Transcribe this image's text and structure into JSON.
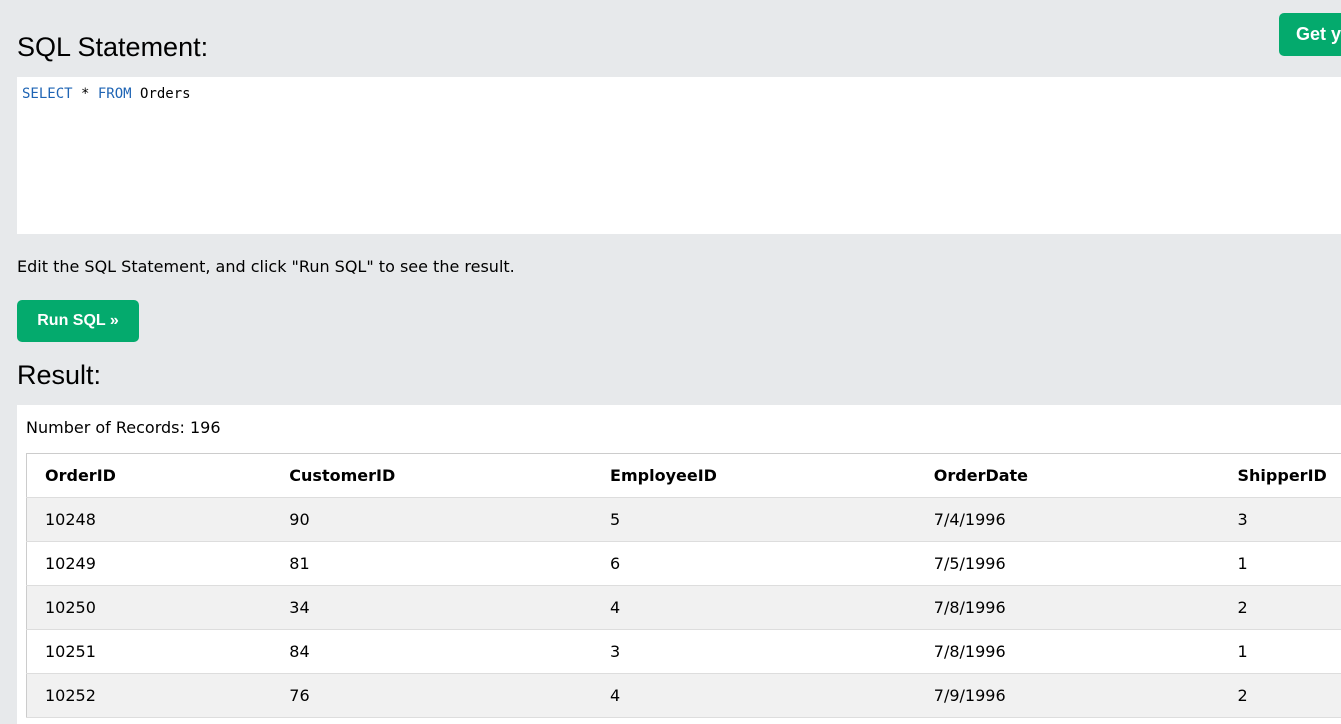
{
  "header": {
    "title": "SQL Statement:",
    "get_button_label": "Get y"
  },
  "editor": {
    "tokens": [
      {
        "text": "SELECT",
        "type": "keyword"
      },
      {
        "text": " * ",
        "type": "plain"
      },
      {
        "text": "FROM",
        "type": "keyword"
      },
      {
        "text": " Orders",
        "type": "plain"
      }
    ]
  },
  "hint": "Edit the SQL Statement, and click \"Run SQL\" to see the result.",
  "run_button_label": "Run SQL »",
  "result": {
    "title": "Result:",
    "records_text": "Number of Records: 196",
    "columns": [
      "OrderID",
      "CustomerID",
      "EmployeeID",
      "OrderDate",
      "ShipperID"
    ],
    "rows": [
      [
        "10248",
        "90",
        "5",
        "7/4/1996",
        "3"
      ],
      [
        "10249",
        "81",
        "6",
        "7/5/1996",
        "1"
      ],
      [
        "10250",
        "34",
        "4",
        "7/8/1996",
        "2"
      ],
      [
        "10251",
        "84",
        "3",
        "7/8/1996",
        "1"
      ],
      [
        "10252",
        "76",
        "4",
        "7/9/1996",
        "2"
      ]
    ]
  },
  "colors": {
    "accent_green": "#04aa6d",
    "keyword_blue": "#1e64b4",
    "background": "#e7e9eb"
  }
}
